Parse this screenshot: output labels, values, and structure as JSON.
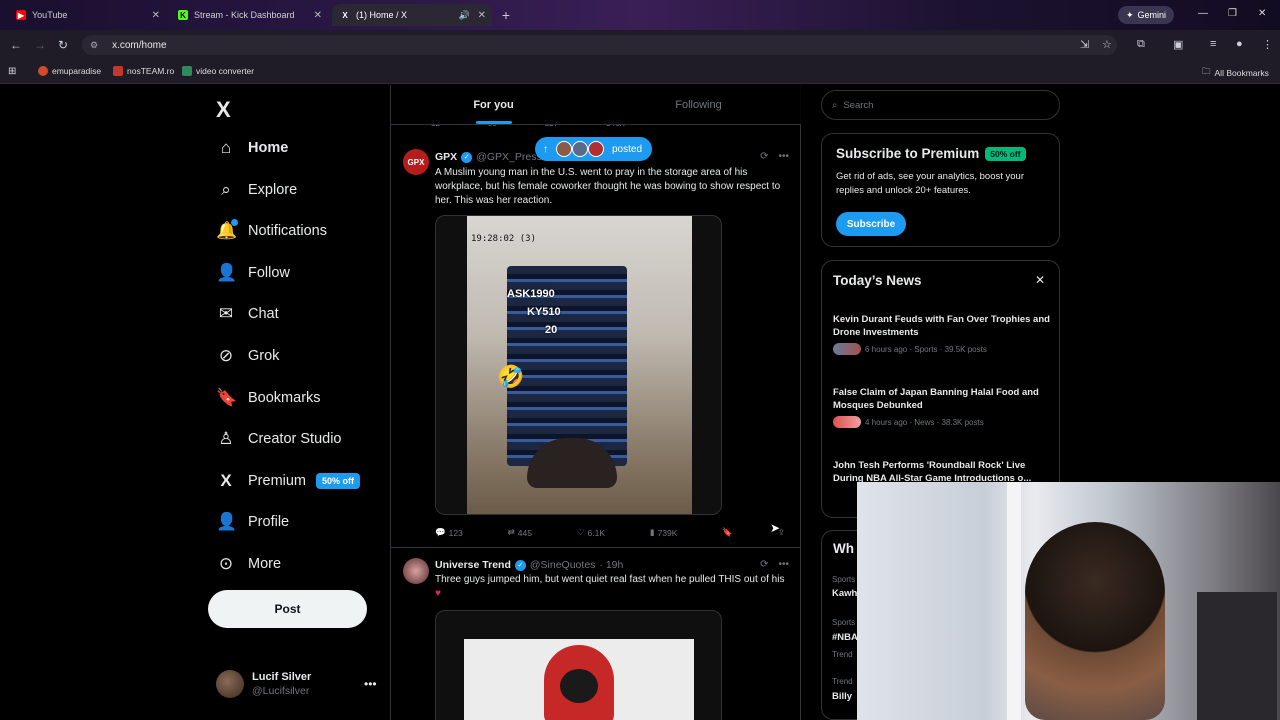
{
  "browser": {
    "tabs": [
      {
        "title": "YouTube",
        "color": "#ff0000",
        "icon": "youtube-icon"
      },
      {
        "title": "Stream - Kick Dashboard",
        "color": "#53fc18",
        "icon": "kick-icon"
      },
      {
        "title": "(1) Home / X",
        "color": "#ffffff",
        "icon": "x-icon"
      }
    ],
    "gemini_label": "Gemini",
    "url": "x.com/home",
    "bookmarks": [
      "emuparadise",
      "nosTEAM.ro",
      "video converter"
    ],
    "all_bookmarks": "All Bookmarks"
  },
  "nav": {
    "items": [
      {
        "label": "Home",
        "icon": "home-icon"
      },
      {
        "label": "Explore",
        "icon": "search-icon"
      },
      {
        "label": "Notifications",
        "icon": "bell-icon"
      },
      {
        "label": "Follow",
        "icon": "follow-icon"
      },
      {
        "label": "Chat",
        "icon": "mail-icon"
      },
      {
        "label": "Grok",
        "icon": "grok-icon"
      },
      {
        "label": "Bookmarks",
        "icon": "bookmark-icon"
      },
      {
        "label": "Creator Studio",
        "icon": "creator-icon"
      },
      {
        "label": "Premium",
        "icon": "x-icon"
      },
      {
        "label": "Profile",
        "icon": "profile-icon"
      },
      {
        "label": "More",
        "icon": "more-icon"
      }
    ],
    "premium_badge": "50% off",
    "post_button": "Post",
    "account": {
      "name": "Lucif Silver",
      "handle": "@Lucifsilver"
    }
  },
  "feed": {
    "tabs": [
      "For you",
      "Following"
    ],
    "ghost_stats": [
      "12",
      "33",
      "227",
      "346K"
    ],
    "posted_pill": "posted",
    "tweets": [
      {
        "name": "GPX",
        "handle": "@GPX_Press",
        "text": "A Muslim young man in the U.S. went to pray in the storage area of his workplace, but his female coworker thought he was bowing to show respect to her. This was her reaction.",
        "video_timestamp": "19:28:02 (3)",
        "overlay_text": [
          "ASK1990",
          "KY510",
          "20"
        ],
        "replies": "123",
        "reposts": "445",
        "likes": "6.1K",
        "views": "739K"
      },
      {
        "name": "Universe Trend",
        "handle": "@SineQuotes",
        "time": "· 19h",
        "text": "Three guys jumped him, but went quiet real fast when he pulled THIS out of his"
      }
    ]
  },
  "right": {
    "search_placeholder": "Search",
    "premium": {
      "title": "Subscribe to Premium",
      "badge": "50% off",
      "desc": "Get rid of ads, see your analytics, boost your replies and unlock 20+ features.",
      "button": "Subscribe"
    },
    "news": {
      "title": "Today’s News",
      "items": [
        {
          "title": "Kevin Durant Feuds with Fan Over Trophies and Drone Investments",
          "meta": "6 hours ago · Sports · 39.5K posts"
        },
        {
          "title": "False Claim of Japan Banning Halal Food and Mosques Debunked",
          "meta": "4 hours ago · News · 38.3K posts"
        },
        {
          "title": "John Tesh Performs 'Roundball Rock' Live During NBA All-Star Game Introductions o...",
          "meta": ""
        }
      ]
    },
    "whats_happening_partial": "Wh",
    "trends_partial": [
      {
        "cat": "Sports",
        "name": "Kawh"
      },
      {
        "cat": "Sports",
        "name": "#NBA"
      },
      {
        "cat": "Trend",
        "name": ""
      },
      {
        "cat": "Trend",
        "name": "Billy"
      }
    ]
  }
}
